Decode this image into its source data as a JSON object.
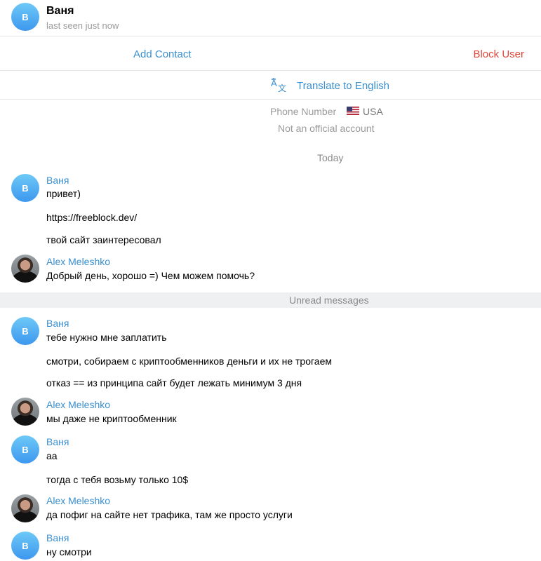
{
  "header": {
    "avatar_initial": "В",
    "name": "Ваня",
    "status": "last seen just now"
  },
  "actions": {
    "add_contact": "Add Contact",
    "block_user": "Block User"
  },
  "translate": {
    "label": "Translate to English",
    "icon": "translate-icon"
  },
  "info": {
    "phone_label": "Phone Number",
    "country_flag": "us-flag-icon",
    "country": "USA",
    "official_note": "Not an official account"
  },
  "date_separator": "Today",
  "unread_label": "Unread messages",
  "colors": {
    "accent": "#3a8fcf",
    "danger": "#e0453a",
    "avatar_gradient_top": "#6ec9f7",
    "avatar_gradient_bottom": "#3d97ee",
    "unread_bar": "#eef0f1"
  },
  "messages": [
    {
      "sender": "Ваня",
      "avatar_initial": "В",
      "lines": [
        "привет)",
        "https://freeblock.dev/",
        "твой сайт заинтересовал"
      ]
    },
    {
      "sender": "Alex Meleshko",
      "lines": [
        "Добрый день, хорошо =) Чем можем помочь?"
      ]
    },
    {
      "sender": "Ваня",
      "avatar_initial": "В",
      "lines": [
        "тебе нужно мне заплатить",
        "смотри, собираем с криптообменников деньги и их не трогаем",
        "отказ == из принципа сайт будет лежать минимум 3 дня"
      ]
    },
    {
      "sender": "Alex Meleshko",
      "lines": [
        "мы даже не криптообменник"
      ]
    },
    {
      "sender": "Ваня",
      "avatar_initial": "В",
      "lines": [
        "аа",
        "тогда с тебя возьму только 10$"
      ]
    },
    {
      "sender": "Alex Meleshko",
      "lines": [
        "да пофиг на сайте нет трафика, там же просто услуги"
      ]
    },
    {
      "sender": "Ваня",
      "avatar_initial": "В",
      "lines": [
        "ну смотри"
      ]
    }
  ]
}
